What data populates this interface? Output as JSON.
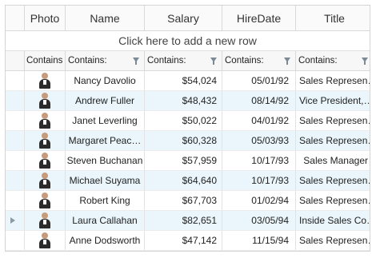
{
  "columns": {
    "photo": "Photo",
    "name": "Name",
    "salary": "Salary",
    "hiredate": "HireDate",
    "title": "Title"
  },
  "new_row_text": "Click here to add a new row",
  "filters": {
    "photo": "Contains",
    "name": "Contains:",
    "salary": "Contains:",
    "hiredate": "Contains:",
    "title": "Contains:"
  },
  "rows": [
    {
      "name": "Nancy Davolio",
      "salary": "$54,024",
      "hiredate": "05/01/92",
      "title": "Sales  Represen…"
    },
    {
      "name": "Andrew Fuller",
      "salary": "$48,432",
      "hiredate": "08/14/92",
      "title": "Vice  President,…"
    },
    {
      "name": "Janet Leverling",
      "salary": "$50,022",
      "hiredate": "04/01/92",
      "title": "Sales  Represen…"
    },
    {
      "name": "Margaret  Peac…",
      "salary": "$60,328",
      "hiredate": "05/03/93",
      "title": "Sales  Represen…"
    },
    {
      "name": "Steven Buchanan",
      "salary": "$57,959",
      "hiredate": "10/17/93",
      "title": "Sales Manager"
    },
    {
      "name": "Michael Suyama",
      "salary": "$64,640",
      "hiredate": "10/17/93",
      "title": "Sales  Represen…"
    },
    {
      "name": "Robert King",
      "salary": "$67,703",
      "hiredate": "01/02/94",
      "title": "Sales  Represen…"
    },
    {
      "name": "Laura Callahan",
      "salary": "$82,651",
      "hiredate": "03/05/94",
      "title": "Inside  Sales  Co…"
    },
    {
      "name": "Anne Dodsworth",
      "salary": "$47,142",
      "hiredate": "11/15/94",
      "title": "Sales  Represen…"
    }
  ],
  "colors": {
    "alt_row": "#eaf6fc",
    "header_bg": "#fafafa",
    "border": "#d9d9d9"
  },
  "icons": {
    "filter": "funnel-icon",
    "current_row": "row-indicator-arrow-icon",
    "photo": "employee-photo"
  }
}
